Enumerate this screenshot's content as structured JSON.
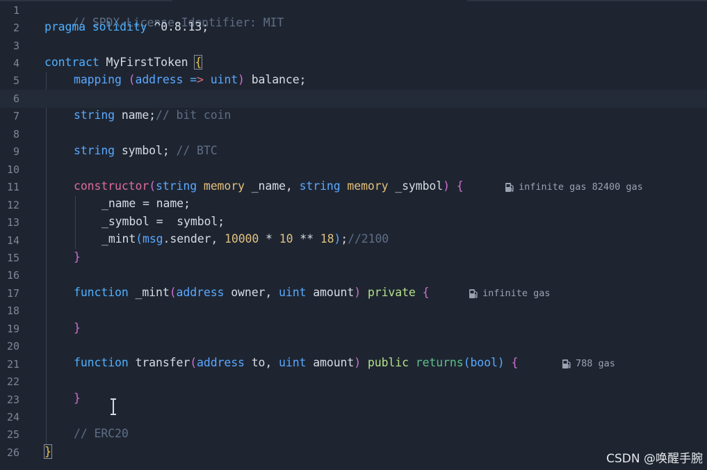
{
  "editor": {
    "lines": [
      {
        "n": "1"
      },
      {
        "n": "2"
      },
      {
        "n": "3"
      },
      {
        "n": "4"
      },
      {
        "n": "5"
      },
      {
        "n": "6"
      },
      {
        "n": "7"
      },
      {
        "n": "8"
      },
      {
        "n": "9"
      },
      {
        "n": "10"
      },
      {
        "n": "11"
      },
      {
        "n": "12"
      },
      {
        "n": "13"
      },
      {
        "n": "14"
      },
      {
        "n": "15"
      },
      {
        "n": "16"
      },
      {
        "n": "17"
      },
      {
        "n": "18"
      },
      {
        "n": "19"
      },
      {
        "n": "20"
      },
      {
        "n": "21"
      },
      {
        "n": "22"
      },
      {
        "n": "23"
      },
      {
        "n": "24"
      },
      {
        "n": "25"
      },
      {
        "n": "26"
      }
    ],
    "code": {
      "l1": "// SPDX-License-Identifier: MIT",
      "l2_a": "pragma",
      "l2_b": " solidity ",
      "l2_c": "^0.8.13;",
      "l4_a": "contract",
      "l4_b": " MyFirstToken ",
      "l4_c": "{",
      "l5_a": "mapping",
      "l5_b": " (",
      "l5_c": "address",
      "l5_d": " =",
      "l5_e": ">",
      "l5_f": " uint",
      "l5_g": ")",
      "l5_h": " balance;",
      "l7_a": "string",
      "l7_b": " name;",
      "l7_c": "// bit coin",
      "l9_a": "string",
      "l9_b": " symbol; ",
      "l9_c": "// BTC",
      "l11_a": "constructor",
      "l11_b": "(",
      "l11_c": "string",
      "l11_d": " memory",
      "l11_e": " _name, ",
      "l11_f": "string",
      "l11_g": " memory",
      "l11_h": " _symbol",
      "l11_i": ")",
      "l11_j": " {",
      "l12": "_name = name;",
      "l13": "_symbol =  symbol;",
      "l14_a": "_mint",
      "l14_b": "(",
      "l14_c": "msg",
      "l14_d": ".sender, ",
      "l14_e": "10000",
      "l14_f": " * ",
      "l14_g": "10",
      "l14_h": " ** ",
      "l14_i": "18",
      "l14_j": ")",
      "l14_k": ";",
      "l14_l": "//2100",
      "l15": "}",
      "l17_a": "function",
      "l17_b": " _mint",
      "l17_c": "(",
      "l17_d": "address",
      "l17_e": " owner, ",
      "l17_f": "uint",
      "l17_g": " amount",
      "l17_h": ")",
      "l17_i": " private",
      "l17_j": " {",
      "l19": "}",
      "l21_a": "function",
      "l21_b": " transfer",
      "l21_c": "(",
      "l21_d": "address",
      "l21_e": " to, ",
      "l21_f": "uint",
      "l21_g": " amount",
      "l21_h": ")",
      "l21_i": " public",
      "l21_j": " returns",
      "l21_k": "(",
      "l21_l": "bool",
      "l21_m": ")",
      "l21_n": " {",
      "l23": "}",
      "l25": "// ERC20",
      "l26": "}"
    },
    "gas_hints": {
      "constructor": "infinite gas 82400 gas",
      "mint": "infinite gas",
      "transfer": "788 gas"
    },
    "current_line": 6
  },
  "watermark": "CSDN @唤醒手腕",
  "icons": {
    "gas": "gas-pump-icon",
    "cursor": "text-cursor-icon"
  },
  "colors": {
    "background": "#1e2531",
    "comment": "#5f6e86",
    "keyword": "#c678dd",
    "type": "#5aa8ff"
  }
}
